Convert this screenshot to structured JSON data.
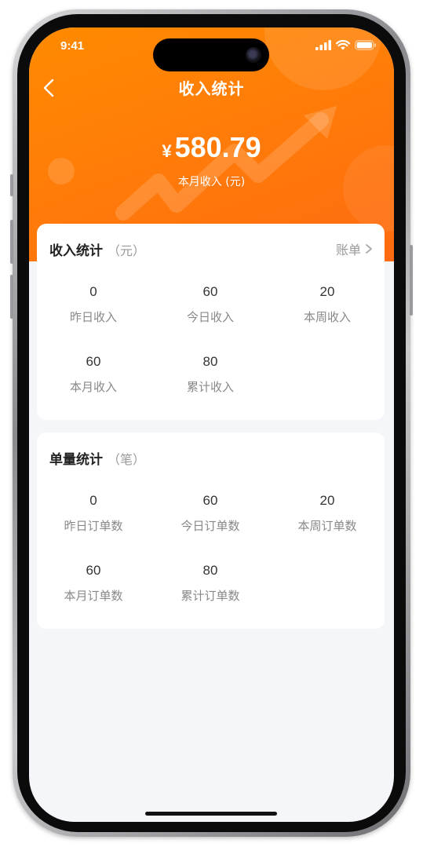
{
  "status_bar": {
    "time": "9:41"
  },
  "nav": {
    "title": "收入统计",
    "back_icon": "chevron-left-icon"
  },
  "summary": {
    "currency": "¥",
    "amount": "580.79",
    "caption": "本月收入 (元)"
  },
  "income_card": {
    "title": "收入统计",
    "unit": "（元）",
    "link_label": "账单",
    "stats": [
      {
        "value": "0",
        "label": "昨日收入"
      },
      {
        "value": "60",
        "label": "今日收入"
      },
      {
        "value": "20",
        "label": "本周收入"
      },
      {
        "value": "60",
        "label": "本月收入"
      },
      {
        "value": "80",
        "label": "累计收入"
      }
    ]
  },
  "order_card": {
    "title": "单量统计",
    "unit": "（笔）",
    "stats": [
      {
        "value": "0",
        "label": "昨日订单数"
      },
      {
        "value": "60",
        "label": "今日订单数"
      },
      {
        "value": "20",
        "label": "本周订单数"
      },
      {
        "value": "60",
        "label": "本月订单数"
      },
      {
        "value": "80",
        "label": "累计订单数"
      }
    ]
  },
  "colors": {
    "header_orange": "#ff7a0a",
    "page_background": "#f5f6fa",
    "card_background": "#ffffff"
  }
}
